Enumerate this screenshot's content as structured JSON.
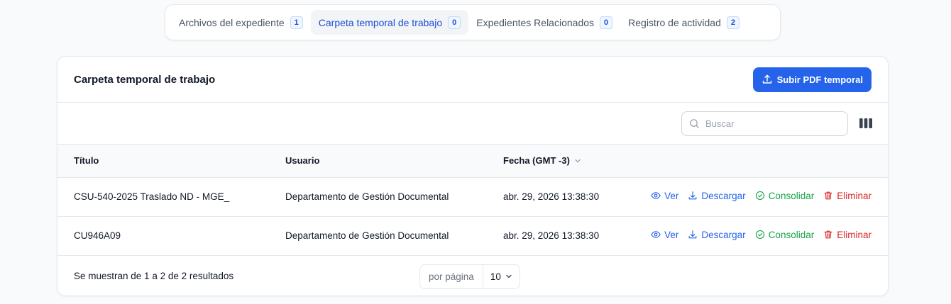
{
  "tabs": [
    {
      "label": "Archivos del expediente",
      "count": "1"
    },
    {
      "label": "Carpeta temporal de trabajo",
      "count": "0"
    },
    {
      "label": "Expedientes Relacionados",
      "count": "0"
    },
    {
      "label": "Registro de actividad",
      "count": "2"
    }
  ],
  "active_tab": 1,
  "card": {
    "title": "Carpeta temporal de trabajo",
    "upload_label": "Subir PDF temporal"
  },
  "search": {
    "placeholder": "Buscar"
  },
  "table": {
    "headers": {
      "title": "Título",
      "user": "Usuario",
      "date": "Fecha (GMT -3)"
    },
    "actions": {
      "view": "Ver",
      "download": "Descargar",
      "consolidate": "Consolidar",
      "delete": "Eliminar"
    },
    "rows": [
      {
        "title": "CSU-540-2025 Traslado ND - MGE_",
        "user": "Departamento de Gestión Documental",
        "date": "abr. 29, 2026 13:38:30"
      },
      {
        "title": "CU946A09",
        "user": "Departamento de Gestión Documental",
        "date": "abr. 29, 2026 13:38:30"
      }
    ]
  },
  "footer": {
    "summary": "Se muestran de 1 a 2 de 2 resultados",
    "per_page_label": "por página",
    "per_page_value": "10"
  },
  "colors": {
    "primary": "#2563eb",
    "success": "#16a34a",
    "danger": "#dc2626"
  }
}
